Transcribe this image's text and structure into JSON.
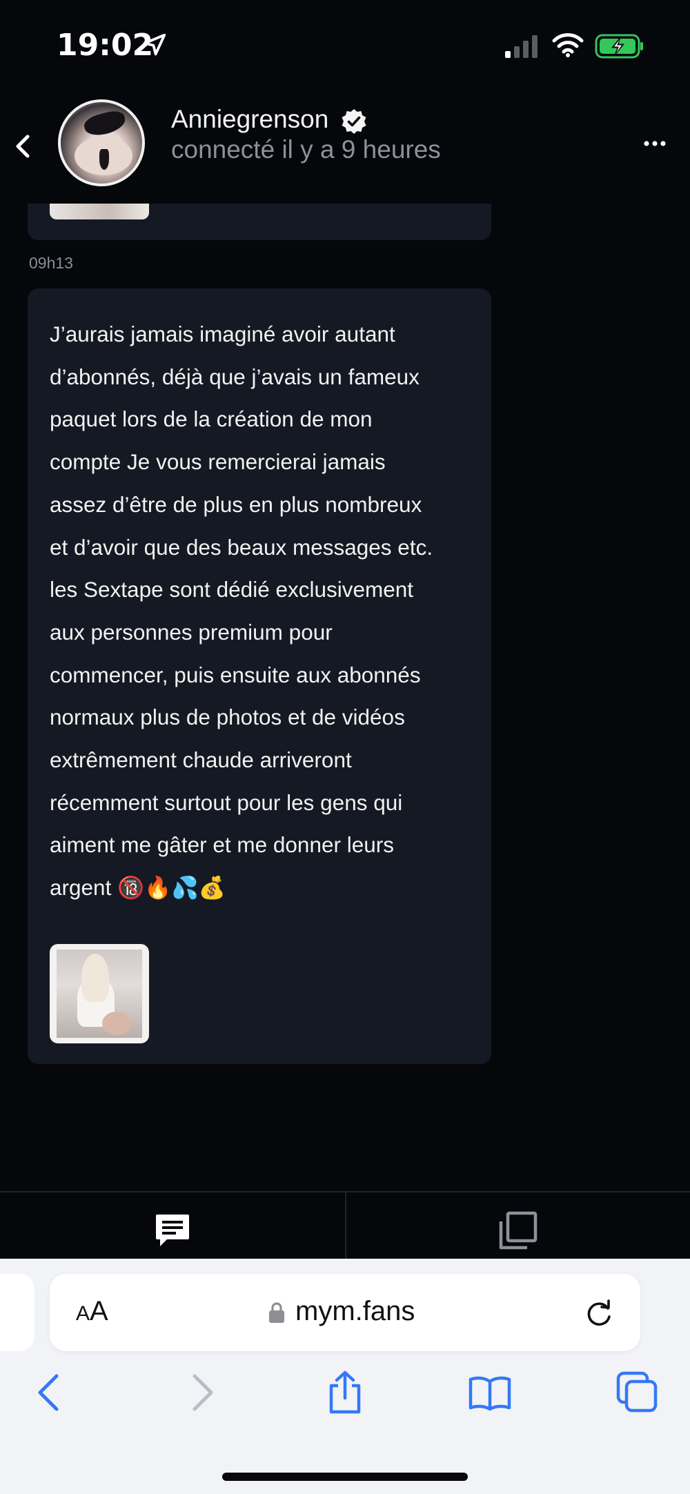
{
  "status_bar": {
    "time": "19:02",
    "icons": [
      "location-arrow-icon",
      "cellular-signal-icon",
      "wifi-icon",
      "battery-charging-icon"
    ],
    "battery_color": "#34c759"
  },
  "chat_header": {
    "user_name": "Anniegrenson",
    "user_status": "connecté il y a 9 heures",
    "icons": [
      "back-chevron-icon",
      "verified-badge-icon",
      "more-dots-icon"
    ]
  },
  "messages": [
    {
      "time": "09h13",
      "text": "J’aurais jamais imaginé avoir autant\nd’abonnés, déjà que j’avais un fameux\npaquet lors de la création de mon\ncompte Je vous remercierai jamais\nassez d’être de plus en plus nombreux\net d’avoir que des beaux messages etc.\nles Sextape sont dédié exclusivement\naux personnes premium pour\ncommencer, puis ensuite aux abonnés\nnormaux plus de photos et de vidéos\nextrêmement chaude arriveront\nrécemment surtout pour les gens qui\naiment me gâter et me donner leurs\nargent 🔞🔥💦💰"
    }
  ],
  "tabbar": {
    "icons": [
      "chat-bubble-icon",
      "gallery-icon"
    ]
  },
  "safari": {
    "text_size_label_small": "A",
    "text_size_label_big": "A",
    "url": "mym.fans",
    "icons": [
      "lock-icon",
      "reload-icon",
      "back-arrow-icon",
      "forward-arrow-icon",
      "share-icon",
      "bookmarks-icon",
      "tabs-icon"
    ],
    "accent_color": "#3478f6"
  }
}
